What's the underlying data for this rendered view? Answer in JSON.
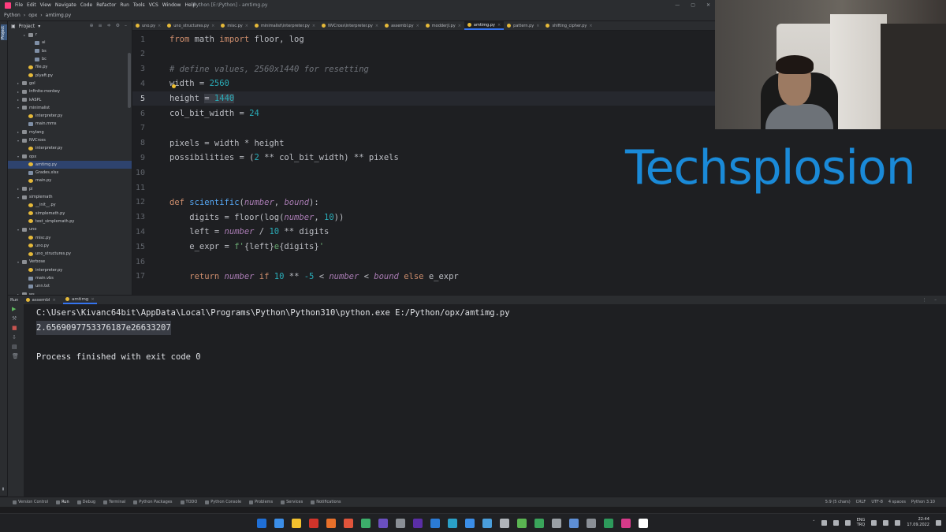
{
  "window": {
    "title": "Python [E:\\Python] - amtimg.py",
    "menu": [
      "File",
      "Edit",
      "View",
      "Navigate",
      "Code",
      "Refactor",
      "Run",
      "Tools",
      "VCS",
      "Window",
      "Help"
    ],
    "controls": [
      "—",
      "▢",
      "✕"
    ]
  },
  "nav": {
    "breadcrumb": [
      "Python",
      "opx",
      "amtimg.py"
    ]
  },
  "project": {
    "header": "Project",
    "tree": [
      {
        "label": "r",
        "type": "folder",
        "indent": 2,
        "arrow": "▸"
      },
      {
        "label": "ai",
        "type": "file",
        "indent": 3,
        "arrow": ""
      },
      {
        "label": "bs",
        "type": "file",
        "indent": 3,
        "arrow": ""
      },
      {
        "label": "bc",
        "type": "file",
        "indent": 3,
        "arrow": ""
      },
      {
        "label": "file.py",
        "type": "py",
        "indent": 2,
        "arrow": ""
      },
      {
        "label": "plyaft.py",
        "type": "py",
        "indent": 2,
        "arrow": ""
      },
      {
        "label": "gol",
        "type": "folder",
        "indent": 1,
        "arrow": "▸"
      },
      {
        "label": "infinite-monkey",
        "type": "folder",
        "indent": 1,
        "arrow": "▸"
      },
      {
        "label": "kASPL",
        "type": "folder",
        "indent": 1,
        "arrow": "▸"
      },
      {
        "label": "minimalist",
        "type": "folder",
        "indent": 1,
        "arrow": "▾"
      },
      {
        "label": "interpreter.py",
        "type": "py",
        "indent": 2,
        "arrow": ""
      },
      {
        "label": "main.mms",
        "type": "file",
        "indent": 2,
        "arrow": ""
      },
      {
        "label": "mylang",
        "type": "folder",
        "indent": 1,
        "arrow": "▸"
      },
      {
        "label": "NVCross",
        "type": "folder",
        "indent": 1,
        "arrow": "▾"
      },
      {
        "label": "interpreter.py",
        "type": "py",
        "indent": 2,
        "arrow": ""
      },
      {
        "label": "opx",
        "type": "folder",
        "indent": 1,
        "arrow": "▾"
      },
      {
        "label": "amtimg.py",
        "type": "py",
        "indent": 2,
        "arrow": "",
        "selected": true
      },
      {
        "label": "Grades.xlsx",
        "type": "file",
        "indent": 2,
        "arrow": ""
      },
      {
        "label": "main.py",
        "type": "py",
        "indent": 2,
        "arrow": ""
      },
      {
        "label": "pl",
        "type": "folder",
        "indent": 1,
        "arrow": "▸"
      },
      {
        "label": "simplemath",
        "type": "folder",
        "indent": 1,
        "arrow": "▾"
      },
      {
        "label": "__init__.py",
        "type": "py",
        "indent": 2,
        "arrow": ""
      },
      {
        "label": "simplemath.py",
        "type": "py",
        "indent": 2,
        "arrow": ""
      },
      {
        "label": "test_simplemath.py",
        "type": "py",
        "indent": 2,
        "arrow": ""
      },
      {
        "label": "uno",
        "type": "folder",
        "indent": 1,
        "arrow": "▾"
      },
      {
        "label": "misc.py",
        "type": "py",
        "indent": 2,
        "arrow": ""
      },
      {
        "label": "uno.py",
        "type": "py",
        "indent": 2,
        "arrow": ""
      },
      {
        "label": "uno_structures.py",
        "type": "py",
        "indent": 2,
        "arrow": ""
      },
      {
        "label": "Verbose",
        "type": "folder",
        "indent": 1,
        "arrow": "▾"
      },
      {
        "label": "interpreter.py",
        "type": "py",
        "indent": 2,
        "arrow": ""
      },
      {
        "label": "main.vbs",
        "type": "file",
        "indent": 2,
        "arrow": ""
      },
      {
        "label": "unn.txt",
        "type": "file",
        "indent": 2,
        "arrow": ""
      },
      {
        "label": "ws",
        "type": "folder",
        "indent": 1,
        "arrow": "▸"
      }
    ]
  },
  "tabs": [
    {
      "label": "uno.py",
      "active": false
    },
    {
      "label": "uno_structures.py",
      "active": false
    },
    {
      "label": "misc.py",
      "active": false
    },
    {
      "label": "minimalist\\interpreter.py",
      "active": false
    },
    {
      "label": "NVCross\\interpreter.py",
      "active": false
    },
    {
      "label": "assembl.py",
      "active": false
    },
    {
      "label": "modderjl.py",
      "active": false
    },
    {
      "label": "amtimg.py",
      "active": true
    },
    {
      "label": "pattern.py",
      "active": false
    },
    {
      "label": "shifting_cipher.py",
      "active": false
    }
  ],
  "editor": {
    "current_line": 5,
    "lines": [
      {
        "n": 1,
        "tokens": [
          [
            "kw",
            "from "
          ],
          [
            "pr",
            "math "
          ],
          [
            "kw",
            "import "
          ],
          [
            "pr",
            "floor, log"
          ]
        ]
      },
      {
        "n": 2,
        "tokens": []
      },
      {
        "n": 3,
        "tokens": [
          [
            "cm",
            "# define values, 2560x1440 for resetting"
          ]
        ]
      },
      {
        "n": 4,
        "tokens": [
          [
            "pr",
            "width = "
          ],
          [
            "num",
            "2560"
          ]
        ]
      },
      {
        "n": 5,
        "tokens": [
          [
            "pr",
            "height "
          ],
          [
            "sel",
            "= "
          ],
          [
            "selnum",
            "1440"
          ]
        ]
      },
      {
        "n": 6,
        "tokens": [
          [
            "pr",
            "col_bit_width = "
          ],
          [
            "num",
            "24"
          ]
        ]
      },
      {
        "n": 7,
        "tokens": []
      },
      {
        "n": 8,
        "tokens": [
          [
            "pr",
            "pixels = width * height"
          ]
        ]
      },
      {
        "n": 9,
        "tokens": [
          [
            "pr",
            "possibilities = ("
          ],
          [
            "num",
            "2"
          ],
          [
            "pr",
            " ** col_bit_width) ** pixels"
          ]
        ]
      },
      {
        "n": 10,
        "tokens": []
      },
      {
        "n": 11,
        "tokens": []
      },
      {
        "n": 12,
        "tokens": [
          [
            "kw",
            "def "
          ],
          [
            "fn",
            "scientific"
          ],
          [
            "pr",
            "("
          ],
          [
            "par",
            "number"
          ],
          [
            "pr",
            ", "
          ],
          [
            "par",
            "bound"
          ],
          [
            "pr",
            "):"
          ]
        ]
      },
      {
        "n": 13,
        "tokens": [
          [
            "pr",
            "    digits = floor(log("
          ],
          [
            "par",
            "number"
          ],
          [
            "pr",
            ", "
          ],
          [
            "num",
            "10"
          ],
          [
            "pr",
            "))"
          ]
        ]
      },
      {
        "n": 14,
        "tokens": [
          [
            "pr",
            "    left = "
          ],
          [
            "par",
            "number"
          ],
          [
            "pr",
            " / "
          ],
          [
            "num",
            "10"
          ],
          [
            "pr",
            " ** digits"
          ]
        ]
      },
      {
        "n": 15,
        "tokens": [
          [
            "pr",
            "    e_expr = "
          ],
          [
            "str",
            "f'"
          ],
          [
            "pr",
            "{left}"
          ],
          [
            "str",
            "e"
          ],
          [
            "pr",
            "{digits}"
          ],
          [
            "str",
            "'"
          ]
        ]
      },
      {
        "n": 16,
        "tokens": []
      },
      {
        "n": 17,
        "tokens": [
          [
            "kw",
            "    return "
          ],
          [
            "par",
            "number"
          ],
          [
            "kw",
            " if "
          ],
          [
            "num",
            "10"
          ],
          [
            "pr",
            " ** "
          ],
          [
            "num",
            "-5"
          ],
          [
            "pr",
            " < "
          ],
          [
            "par",
            "number"
          ],
          [
            "pr",
            " < "
          ],
          [
            "par",
            "bound"
          ],
          [
            "kw",
            " else "
          ],
          [
            "pr",
            "e_expr"
          ]
        ]
      }
    ]
  },
  "brand": {
    "text": "Techsplosion",
    "color": "#1a8ad8"
  },
  "run": {
    "header": "Run",
    "tabs": [
      {
        "label": "assembl",
        "active": false
      },
      {
        "label": "amtimg",
        "active": true
      }
    ],
    "output": [
      {
        "text": "C:\\Users\\Kivanc64bit\\AppData\\Local\\Programs\\Python\\Python310\\python.exe E:/Python/opx/amtimg.py",
        "selected": false
      },
      {
        "text": "2.6569097753376187e26633207",
        "selected": true
      },
      {
        "text": "",
        "selected": false
      },
      {
        "text": "Process finished with exit code 0",
        "selected": false
      }
    ]
  },
  "bottom_tools": [
    {
      "label": "Version Control",
      "active": false
    },
    {
      "label": "Run",
      "active": true
    },
    {
      "label": "Debug",
      "active": false
    },
    {
      "label": "Terminal",
      "active": false
    },
    {
      "label": "Python Packages",
      "active": false
    },
    {
      "label": "TODO",
      "active": false
    },
    {
      "label": "Python Console",
      "active": false
    },
    {
      "label": "Problems",
      "active": false
    },
    {
      "label": "Services",
      "active": false
    },
    {
      "label": "Notifications",
      "active": false
    }
  ],
  "status": [
    "5:9 (5 chars)",
    "CRLF",
    "UTF-8",
    "4 spaces",
    "Python 3.10"
  ],
  "taskbar": {
    "app_colors": [
      "#1f6fd6",
      "#3b8ee8",
      "#f2c12e",
      "#d1342a",
      "#e8702a",
      "#e0543b",
      "#3cae6a",
      "#6a4fbf",
      "#8a8f96",
      "#5a2ea6",
      "#2b7bd6",
      "#2aa0c8",
      "#3b8ee8",
      "#4a9edb",
      "#b0b4ba",
      "#5ab552",
      "#3aa55b",
      "#9aa0a6",
      "#5e8fd6",
      "#8a8f96",
      "#2d9a5b",
      "#d63a8a",
      "#ffffff"
    ],
    "lang": [
      "ENG",
      "TRQ"
    ],
    "time": "22:44",
    "date": "17.09.2022"
  }
}
